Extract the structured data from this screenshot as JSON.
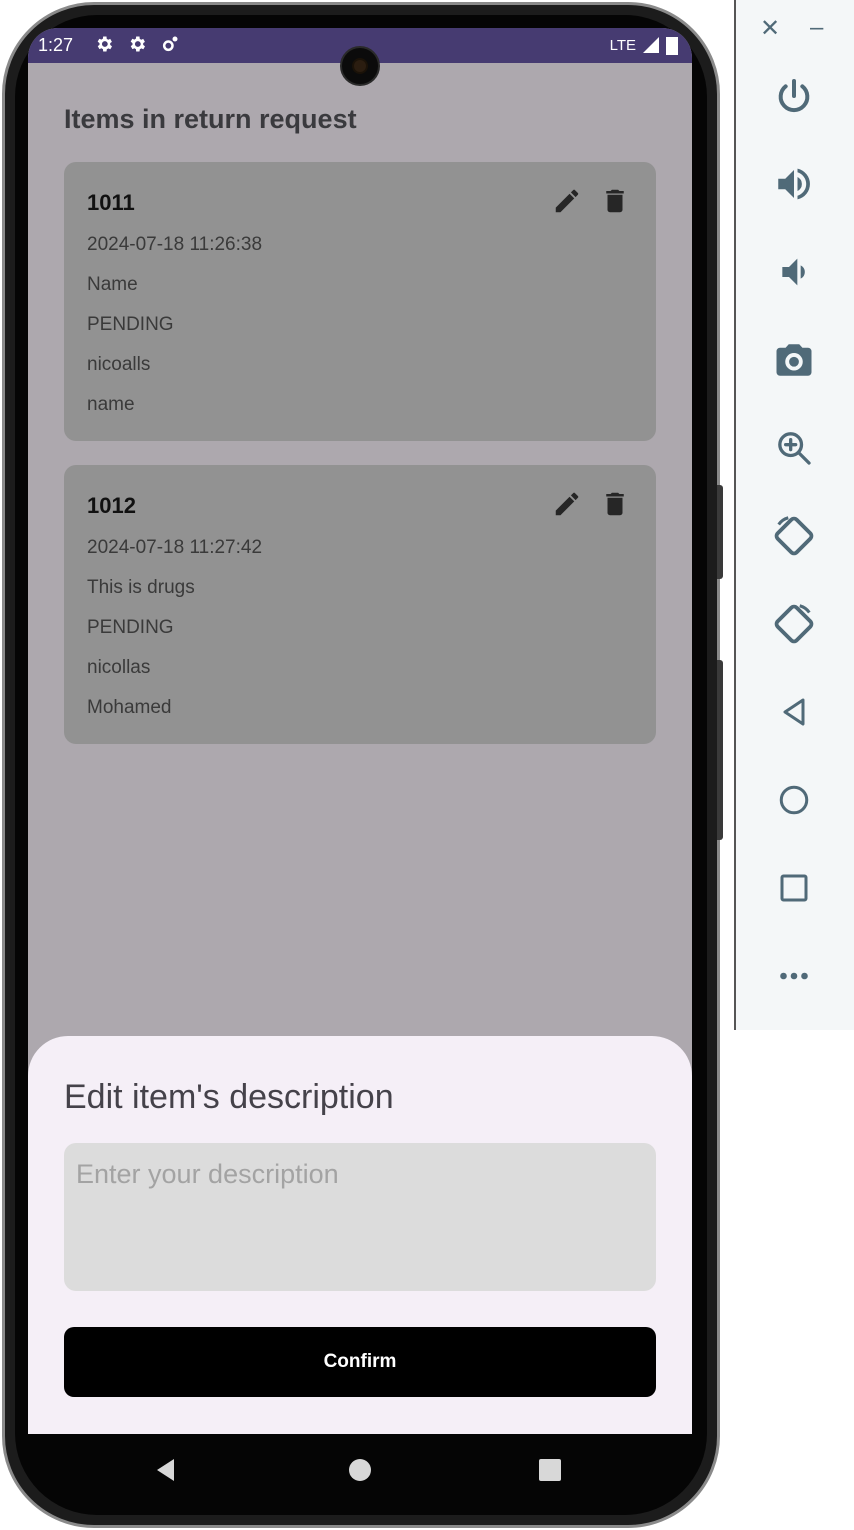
{
  "status_bar": {
    "time": "1:27",
    "network": "LTE"
  },
  "screen": {
    "title": "Items in return request"
  },
  "items": [
    {
      "id": "1011",
      "timestamp": "2024-07-18 11:26:38",
      "description": "Name",
      "status": "PENDING",
      "user": "nicoalls",
      "name": "name"
    },
    {
      "id": "1012",
      "timestamp": "2024-07-18 11:27:42",
      "description": "This is drugs",
      "status": "PENDING",
      "user": "nicollas",
      "name": "Mohamed"
    }
  ],
  "sheet": {
    "title": "Edit item's description",
    "input_value": "",
    "input_placeholder": "Enter your description",
    "confirm_label": "Confirm"
  },
  "colors": {
    "status_bar": "#463b71",
    "scrim_background": "#ada8ae",
    "card": "#929292",
    "sheet": "#f5eff7",
    "confirm_button": "#000000",
    "panel_icon": "#506a78"
  },
  "emulator_panel": {
    "icons": [
      "close-icon",
      "minimize-icon",
      "power-icon",
      "volume-up-icon",
      "volume-down-icon",
      "camera-icon",
      "zoom-in-icon",
      "rotate-left-icon",
      "rotate-right-icon",
      "back-icon",
      "home-icon",
      "overview-icon",
      "more-icon"
    ]
  }
}
